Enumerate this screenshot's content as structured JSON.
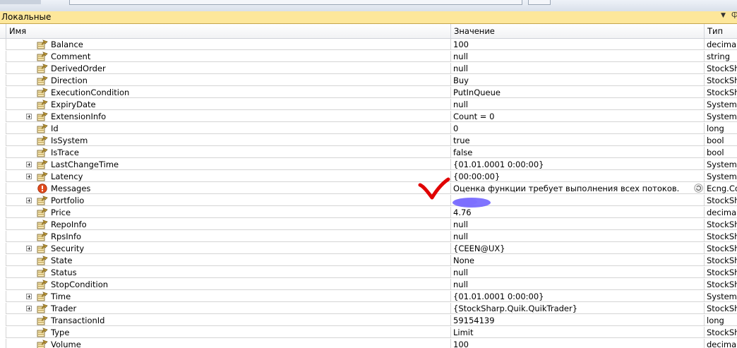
{
  "panel": {
    "title": "Локальные"
  },
  "columns": {
    "name": "Имя",
    "value": "Значение",
    "type": "Тип"
  },
  "colors": {
    "panel_header": "#fde79b",
    "error_icon": "#e04a1c",
    "annotation_check": "#e00000",
    "annotation_blur": "#6a5cff"
  },
  "rows": [
    {
      "name": "Balance",
      "value": "100",
      "type": "decimal",
      "expandable": false,
      "icon": "property-icon"
    },
    {
      "name": "Comment",
      "value": "null",
      "type": "string",
      "expandable": false,
      "icon": "property-icon"
    },
    {
      "name": "DerivedOrder",
      "value": "null",
      "type": "StockSh",
      "expandable": false,
      "icon": "property-icon"
    },
    {
      "name": "Direction",
      "value": "Buy",
      "type": "StockSh",
      "expandable": false,
      "icon": "property-icon"
    },
    {
      "name": "ExecutionCondition",
      "value": "PutInQueue",
      "type": "StockSh",
      "expandable": false,
      "icon": "property-icon"
    },
    {
      "name": "ExpiryDate",
      "value": "null",
      "type": "System.l",
      "expandable": false,
      "icon": "property-icon"
    },
    {
      "name": "ExtensionInfo",
      "value": "Count = 0",
      "type": "System.C",
      "expandable": true,
      "icon": "property-icon"
    },
    {
      "name": "Id",
      "value": "0",
      "type": "long",
      "expandable": false,
      "icon": "property-icon"
    },
    {
      "name": "IsSystem",
      "value": "true",
      "type": "bool",
      "expandable": false,
      "icon": "property-icon"
    },
    {
      "name": "IsTrace",
      "value": "false",
      "type": "bool",
      "expandable": false,
      "icon": "property-icon"
    },
    {
      "name": "LastChangeTime",
      "value": "{01.01.0001 0:00:00}",
      "type": "System.l",
      "expandable": true,
      "icon": "property-icon"
    },
    {
      "name": "Latency",
      "value": "{00:00:00}",
      "type": "System.T",
      "expandable": true,
      "icon": "property-icon"
    },
    {
      "name": "Messages",
      "value": "Оценка функции требует выполнения всех потоков.",
      "type": "Ecng.Co",
      "expandable": false,
      "icon": "error-icon",
      "refresh": true
    },
    {
      "name": "Portfolio",
      "value": "",
      "type": "StockSh",
      "expandable": true,
      "icon": "property-icon"
    },
    {
      "name": "Price",
      "value": "4.76",
      "type": "decimal",
      "expandable": false,
      "icon": "property-icon"
    },
    {
      "name": "RepoInfo",
      "value": "null",
      "type": "StockSh",
      "expandable": false,
      "icon": "property-icon"
    },
    {
      "name": "RpsInfo",
      "value": "null",
      "type": "StockSh",
      "expandable": false,
      "icon": "property-icon"
    },
    {
      "name": "Security",
      "value": "{CEEN@UX}",
      "type": "StockSh",
      "expandable": true,
      "icon": "property-icon"
    },
    {
      "name": "State",
      "value": "None",
      "type": "StockSh",
      "expandable": false,
      "icon": "property-icon"
    },
    {
      "name": "Status",
      "value": "null",
      "type": "StockSh",
      "expandable": false,
      "icon": "property-icon"
    },
    {
      "name": "StopCondition",
      "value": "null",
      "type": "StockSh",
      "expandable": false,
      "icon": "property-icon"
    },
    {
      "name": "Time",
      "value": "{01.01.0001 0:00:00}",
      "type": "System.l",
      "expandable": true,
      "icon": "property-icon"
    },
    {
      "name": "Trader",
      "value": "{StockSharp.Quik.QuikTrader}",
      "type": "StockSh",
      "expandable": true,
      "icon": "property-icon"
    },
    {
      "name": "TransactionId",
      "value": "59154139",
      "type": "long",
      "expandable": false,
      "icon": "property-icon"
    },
    {
      "name": "Type",
      "value": "Limit",
      "type": "StockSh",
      "expandable": false,
      "icon": "property-icon"
    },
    {
      "name": "Volume",
      "value": "100",
      "type": "decimal",
      "expandable": false,
      "icon": "property-icon"
    }
  ]
}
